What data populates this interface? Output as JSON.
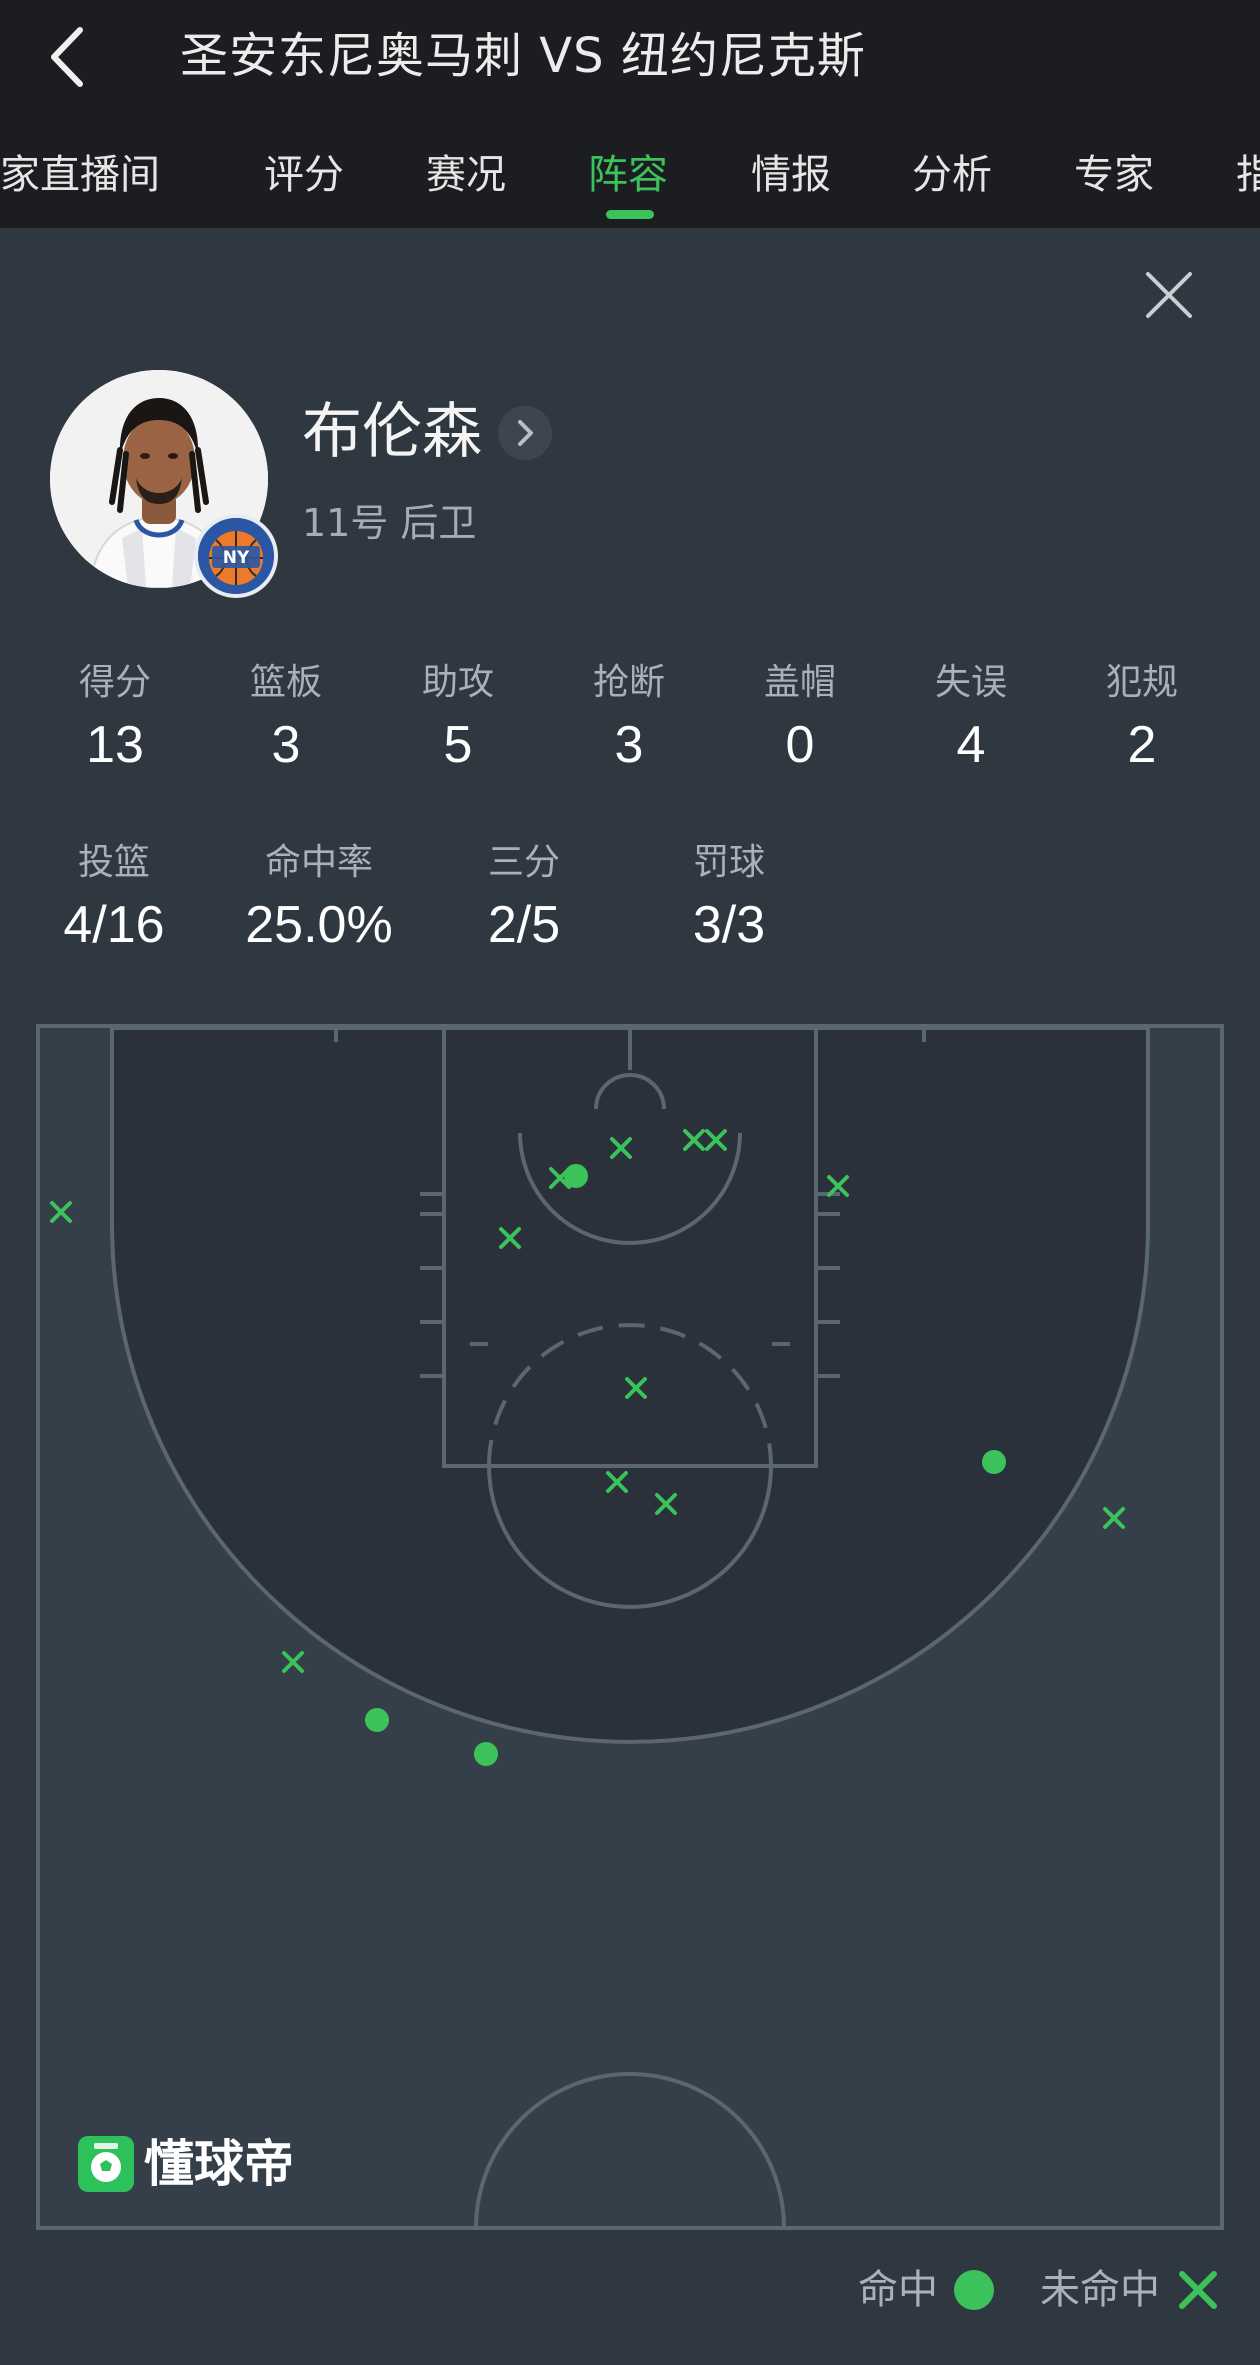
{
  "header": {
    "title": "圣安东尼奥马刺 VS 纽约尼克斯",
    "tabs": [
      {
        "label": "家直播间"
      },
      {
        "label": "评分"
      },
      {
        "label": "赛况"
      },
      {
        "label": "阵容"
      },
      {
        "label": "情报"
      },
      {
        "label": "分析"
      },
      {
        "label": "专家"
      },
      {
        "label": "指"
      }
    ],
    "active_tab": "阵容"
  },
  "player": {
    "name": "布伦森",
    "subtitle": "11号 后卫",
    "team_badge": "NY"
  },
  "stats_row1": [
    {
      "label": "得分",
      "value": "13"
    },
    {
      "label": "篮板",
      "value": "3"
    },
    {
      "label": "助攻",
      "value": "5"
    },
    {
      "label": "抢断",
      "value": "3"
    },
    {
      "label": "盖帽",
      "value": "0"
    },
    {
      "label": "失误",
      "value": "4"
    },
    {
      "label": "犯规",
      "value": "2"
    }
  ],
  "stats_row2": [
    {
      "label": "投篮",
      "value": "4/16"
    },
    {
      "label": "命中率",
      "value": "25.0%"
    },
    {
      "label": "三分",
      "value": "2/5"
    },
    {
      "label": "罚球",
      "value": "3/3"
    }
  ],
  "shot_chart": {
    "made_count": 4,
    "missed_count": 12,
    "made_color": "#3cc25a",
    "missed_color": "#3cc25a"
  },
  "logo_text": "懂球帝",
  "legend": {
    "made": "命中",
    "missed": "未命中"
  },
  "colors": {
    "accent": "#3cc25a",
    "background": "#2f3841",
    "topbar": "#1c1d20"
  }
}
